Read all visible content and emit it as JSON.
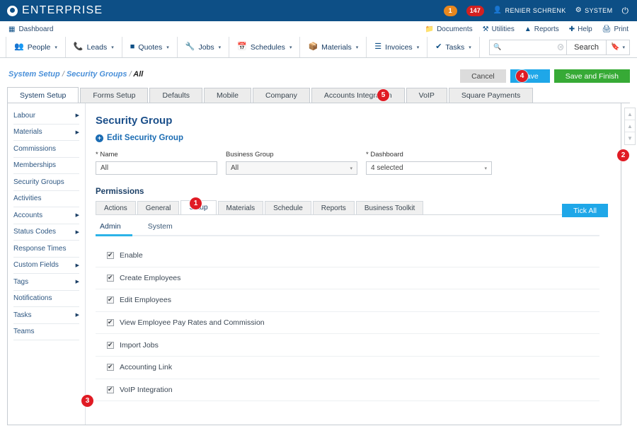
{
  "topbar": {
    "brand": "ENTERPRISE",
    "brand_icon": "circle-logo-icon",
    "badge_orange": "1",
    "badge_red": "147",
    "user_icon": "user-icon",
    "user_name": "RENIER SCHRENK",
    "system_icon": "gear-icon",
    "system_label": "SYSTEM",
    "power_icon": "power-icon"
  },
  "row2": {
    "dashboard_icon": "dashboard-icon",
    "dashboard_label": "Dashboard",
    "links": [
      {
        "label": "Documents",
        "icon": "folder-icon"
      },
      {
        "label": "Utilities",
        "icon": "tools-icon"
      },
      {
        "label": "Reports",
        "icon": "chart-icon"
      },
      {
        "label": "Help",
        "icon": "help-icon"
      },
      {
        "label": "Print",
        "icon": "printer-icon"
      }
    ]
  },
  "nav": {
    "items": [
      {
        "label": "People",
        "icon": "people-icon"
      },
      {
        "label": "Leads",
        "icon": "phone-icon"
      },
      {
        "label": "Quotes",
        "icon": "document-icon"
      },
      {
        "label": "Jobs",
        "icon": "wrench-icon"
      },
      {
        "label": "Schedules",
        "icon": "calendar-icon"
      },
      {
        "label": "Materials",
        "icon": "box-icon"
      },
      {
        "label": "Invoices",
        "icon": "invoice-icon"
      },
      {
        "label": "Tasks",
        "icon": "check-circle-icon"
      }
    ],
    "caret": "▾"
  },
  "search": {
    "value": "",
    "placeholder": "",
    "mag_icon": "search-icon",
    "clear_icon": "clear-icon",
    "button_label": "Search",
    "bookmark_icon": "bookmark-icon",
    "bookmark_caret": "▾"
  },
  "breadcrumb": {
    "part1": "System Setup",
    "sep1": "/",
    "part2": "Security Groups",
    "sep2": "/",
    "current": "All"
  },
  "actions": {
    "cancel": "Cancel",
    "save": "Save",
    "save_and_finish": "Save and Finish"
  },
  "main_tabs": [
    {
      "label": "System Setup",
      "active": true
    },
    {
      "label": "Forms Setup",
      "active": false
    },
    {
      "label": "Defaults",
      "active": false
    },
    {
      "label": "Mobile",
      "active": false
    },
    {
      "label": "Company",
      "active": false
    },
    {
      "label": "Accounts Integration",
      "active": false
    },
    {
      "label": "VoIP",
      "active": false
    },
    {
      "label": "Square Payments",
      "active": false
    }
  ],
  "sidebar": {
    "items": [
      {
        "label": "Labour",
        "has_arrow": true
      },
      {
        "label": "Materials",
        "has_arrow": true
      },
      {
        "label": "Commissions",
        "has_arrow": false
      },
      {
        "label": "Memberships",
        "has_arrow": false
      },
      {
        "label": "Security Groups",
        "has_arrow": false
      },
      {
        "label": "Activities",
        "has_arrow": false
      },
      {
        "label": "Accounts",
        "has_arrow": true
      },
      {
        "label": "Status Codes",
        "has_arrow": true
      },
      {
        "label": "Response Times",
        "has_arrow": false
      },
      {
        "label": "Custom Fields",
        "has_arrow": true
      },
      {
        "label": "Tags",
        "has_arrow": true
      },
      {
        "label": "Notifications",
        "has_arrow": false
      },
      {
        "label": "Tasks",
        "has_arrow": true
      },
      {
        "label": "Teams",
        "has_arrow": false
      }
    ],
    "arrow_glyph": "▶"
  },
  "form": {
    "section_title": "Security Group",
    "edit_link": "Edit Security Group",
    "plus_glyph": "+",
    "name_label": "* Name",
    "name_value": "All",
    "business_group_label": "Business Group",
    "business_group_value": "All",
    "dashboard_label": "* Dashboard",
    "dashboard_value": "4 selected",
    "dropdown_caret": "▾"
  },
  "permissions": {
    "title": "Permissions",
    "tabs": [
      {
        "label": "Actions",
        "active": false
      },
      {
        "label": "General",
        "active": false
      },
      {
        "label": "Setup",
        "active": true
      },
      {
        "label": "Materials",
        "active": false
      },
      {
        "label": "Schedule",
        "active": false
      },
      {
        "label": "Reports",
        "active": false
      },
      {
        "label": "Business Toolkit",
        "active": false
      }
    ],
    "subtabs": [
      {
        "label": "Admin",
        "active": true
      },
      {
        "label": "System",
        "active": false
      }
    ],
    "tick_all": "Tick All",
    "items": [
      {
        "label": "Enable",
        "checked": true
      },
      {
        "label": "Create Employees",
        "checked": true
      },
      {
        "label": "Edit Employees",
        "checked": true
      },
      {
        "label": "View Employee Pay Rates and Commission",
        "checked": true
      },
      {
        "label": "Import Jobs",
        "checked": true
      },
      {
        "label": "Accounting Link",
        "checked": true
      },
      {
        "label": "VoIP Integration",
        "checked": true
      }
    ]
  },
  "scroll_controls": [
    {
      "icon": "arrow-up-icon",
      "glyph": "▲"
    },
    {
      "icon": "arrow-up-icon",
      "glyph": "▲"
    },
    {
      "icon": "arrow-down-icon",
      "glyph": "▼"
    }
  ],
  "markers": {
    "m1": "1",
    "m2": "2",
    "m3": "3",
    "m4": "4",
    "m5": "5"
  },
  "colors": {
    "header_blue": "#0d4f86",
    "accent_blue": "#1fa7e8",
    "green": "#37aa36",
    "marker_red": "#e01b24",
    "badge_orange": "#e8871e",
    "badge_red": "#d32020"
  }
}
